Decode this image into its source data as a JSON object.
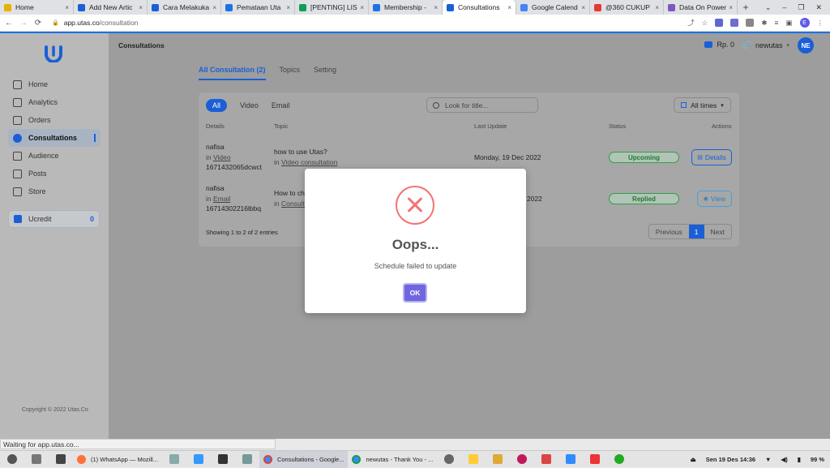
{
  "browser": {
    "tabs": [
      {
        "title": "Home",
        "color": "#e8b100"
      },
      {
        "title": "Add New Artic",
        "color": "#1a5fd6"
      },
      {
        "title": "Cara Melakuka",
        "color": "#1a5fd6"
      },
      {
        "title": "Pemataan Uta",
        "color": "#1a73e8"
      },
      {
        "title": "[PENTING] LIS",
        "color": "#0f9d58"
      },
      {
        "title": "Membership -",
        "color": "#1a73e8"
      },
      {
        "title": "Consultations",
        "color": "#1a5fd6",
        "active": true
      },
      {
        "title": "Google Calend",
        "color": "#4285f4"
      },
      {
        "title": "@360 CUKUP",
        "color": "#e53935"
      },
      {
        "title": "Data On Power",
        "color": "#7e57c2"
      }
    ],
    "tab_close": "×",
    "new_tab": "+",
    "window_controls": [
      "⌄",
      "–",
      "❐",
      "✕"
    ],
    "back": "←",
    "forward": "→",
    "reload": "⟳",
    "url_prefix": "app.utas.co",
    "url_path": "/consultation",
    "profile_initial": "E",
    "status_text": "Waiting for app.utas.co..."
  },
  "sidebar": {
    "items": [
      {
        "label": "Home"
      },
      {
        "label": "Analytics"
      },
      {
        "label": "Orders"
      },
      {
        "label": "Consultations",
        "active": true
      },
      {
        "label": "Audience"
      },
      {
        "label": "Posts"
      },
      {
        "label": "Store"
      }
    ],
    "ucredit_label": "Ucredit",
    "ucredit_value": "0",
    "copyright": "Copyright © 2022 Utas.Co"
  },
  "header": {
    "page_title": "Consultations",
    "wallet": "Rp. 0",
    "username": "newutas",
    "avatar": "NE"
  },
  "tabs": [
    "All Consultation (2)",
    "Topics",
    "Setting"
  ],
  "filters": {
    "types": [
      "All",
      "Video",
      "Email"
    ],
    "search_placeholder": "Look for title...",
    "time_filter": "All times"
  },
  "table": {
    "columns": [
      "Details",
      "Topic",
      "Last Update",
      "Status",
      "Actions"
    ],
    "rows": [
      {
        "name": "nafisa",
        "in_label": "in",
        "channel": "Video",
        "id": "1671432065dcwct",
        "topic": "how to use Utas?",
        "topic_in": "in",
        "topic_channel": "Video consultation",
        "last_update": "Monday, 19 Dec 2022",
        "status": "Upcoming",
        "action": "Details"
      },
      {
        "name": "nafisa",
        "in_label": "in",
        "channel": "Email",
        "id": "16714302216lbbq",
        "topic": "How to ch",
        "topic_in": "in",
        "topic_channel": "Consult",
        "last_update": "2022",
        "status": "Replied",
        "action": "View"
      }
    ],
    "entries_info": "Showing 1 to 2 of 2 entries",
    "pagination": {
      "previous": "Previous",
      "page": "1",
      "next": "Next"
    }
  },
  "modal": {
    "title": "Oops...",
    "message": "Schedule failed to update",
    "ok": "OK"
  },
  "taskbar": {
    "tasks": [
      {
        "label": "(1) WhatsApp — Mozill...",
        "color": "#ff7139"
      },
      {
        "label": "Consultations - Google...",
        "color": "#4285f4",
        "active": true
      },
      {
        "label": "newutas - Thank You - ...",
        "color": "#4285f4"
      }
    ],
    "datetime": "Sen 19 Des  14:36",
    "battery": "99 %"
  }
}
